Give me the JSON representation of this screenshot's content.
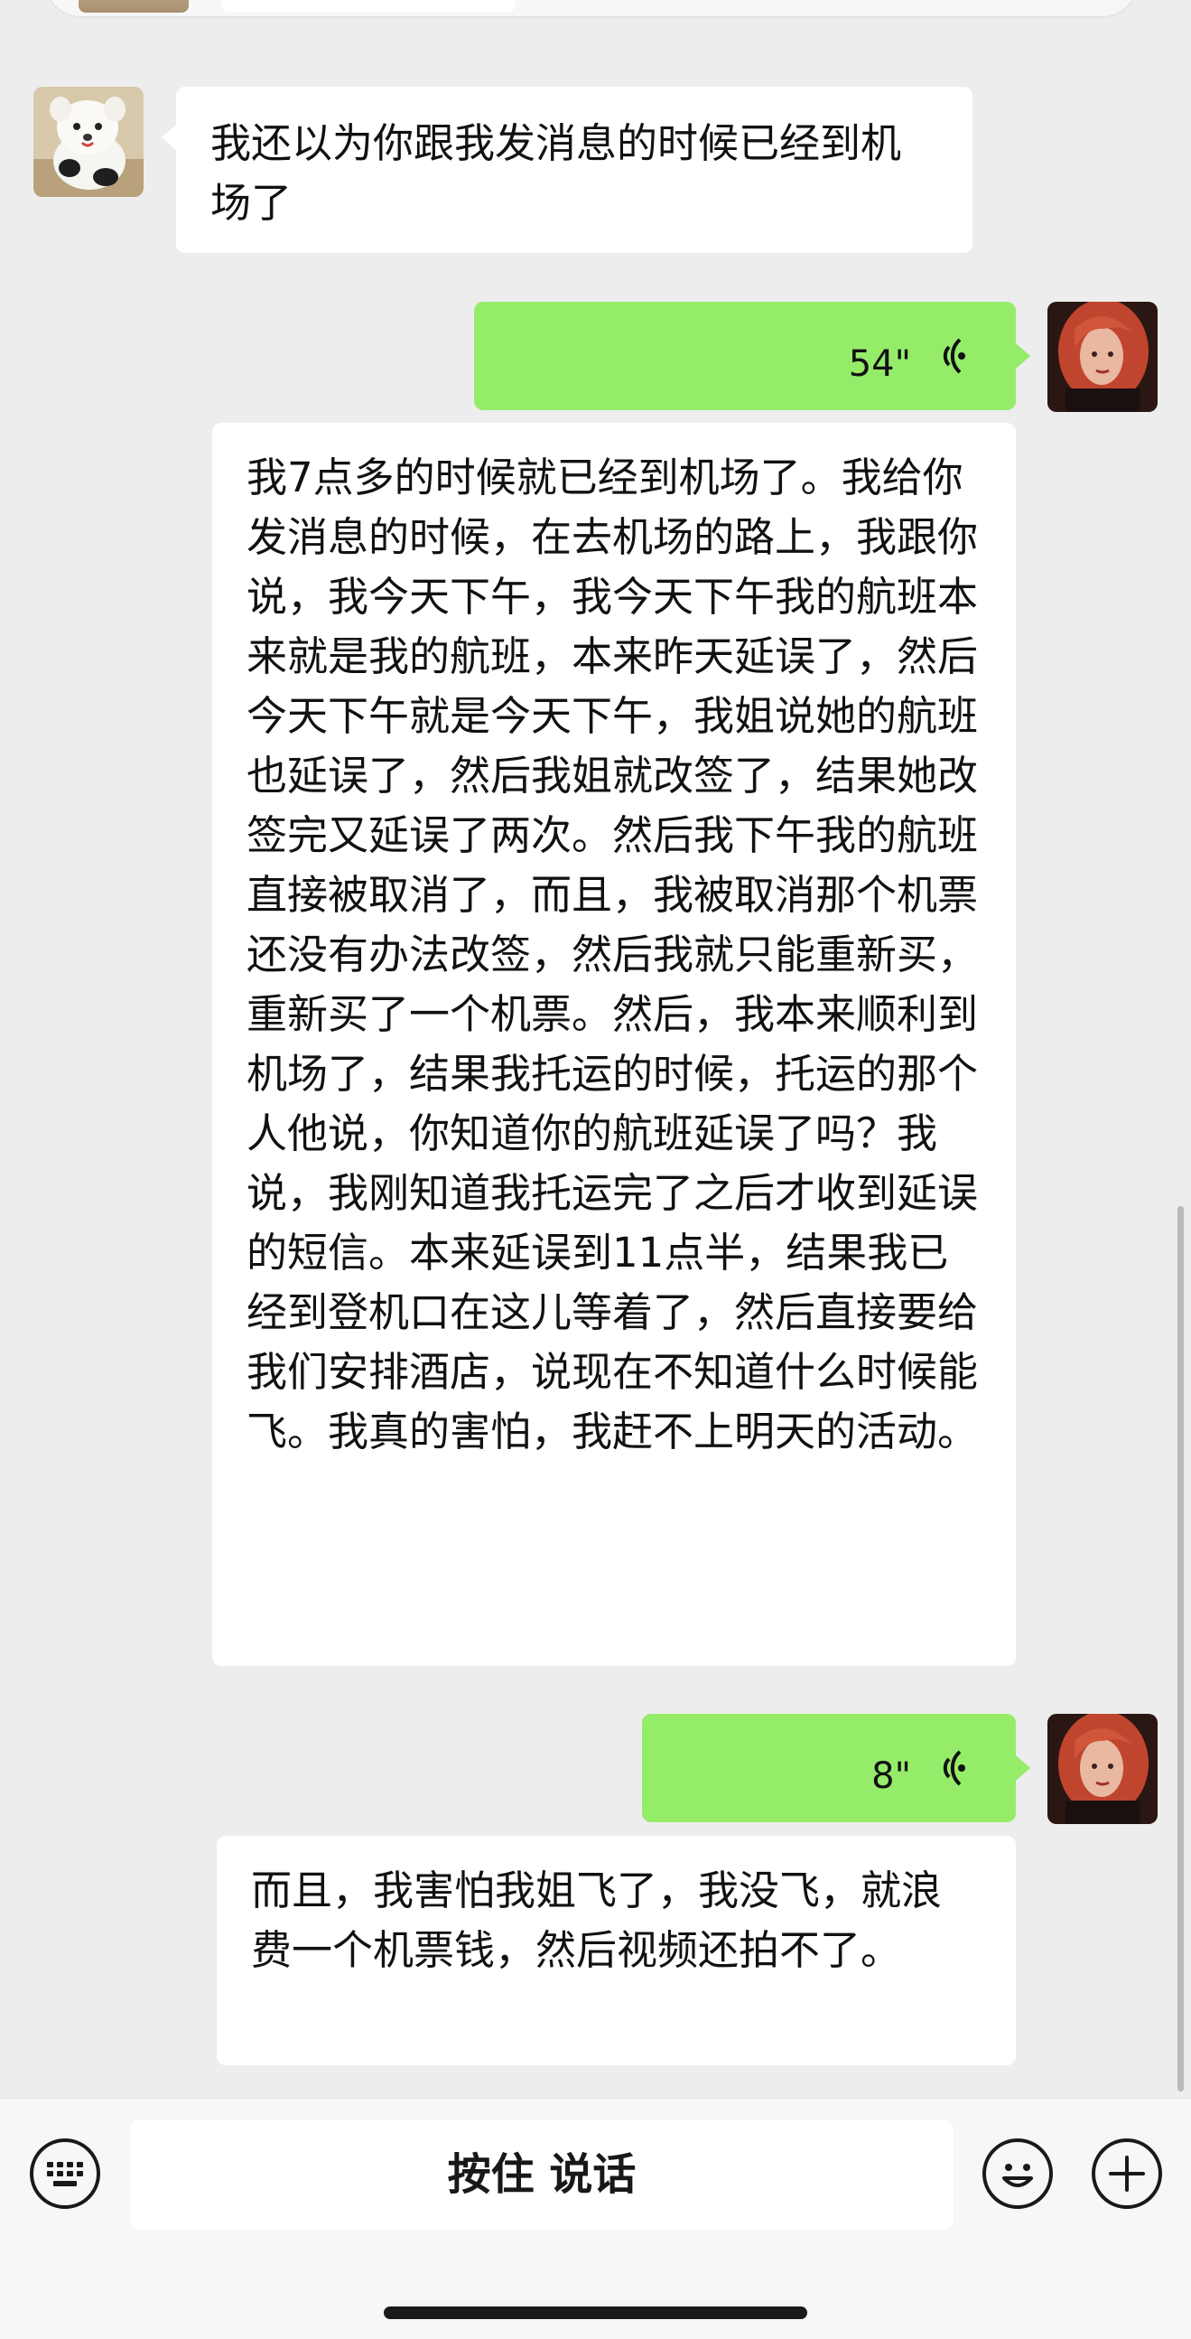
{
  "messages": {
    "m1_text": "我还以为你跟我发消息的时候已经到机场了",
    "v1_duration": "54\"",
    "v1_transcript": "我7点多的时候就已经到机场了。我给你发消息的时候，在去机场的路上，我跟你说，我今天下午，我今天下午我的航班本来就是我的航班，本来昨天延误了，然后今天下午就是今天下午，我姐说她的航班也延误了，然后我姐就改签了，结果她改签完又延误了两次。然后我下午我的航班直接被取消了，而且，我被取消那个机票还没有办法改签，然后我就只能重新买，重新买了一个机票。然后，我本来顺利到机场了，结果我托运的时候，托运的那个人他说，你知道你的航班延误了吗？我说，我刚知道我托运完了之后才收到延误的短信。本来延误到11点半，结果我已经到登机口在这儿等着了，然后直接要给我们安排酒店，说现在不知道什么时候能飞。我真的害怕，我赶不上明天的活动。",
    "v2_duration": "8\"",
    "v2_transcript": "而且，我害怕我姐飞了，我没飞，就浪费一个机票钱，然后视频还拍不了。"
  },
  "input_bar": {
    "hold_to_talk_label": "按住 说话",
    "keyboard_icon": "keyboard-icon",
    "emoji_icon": "emoji-icon",
    "plus_icon": "plus-icon"
  },
  "colors": {
    "background": "#ededed",
    "sent_bubble": "#95ec69",
    "received_bubble": "#ffffff"
  }
}
